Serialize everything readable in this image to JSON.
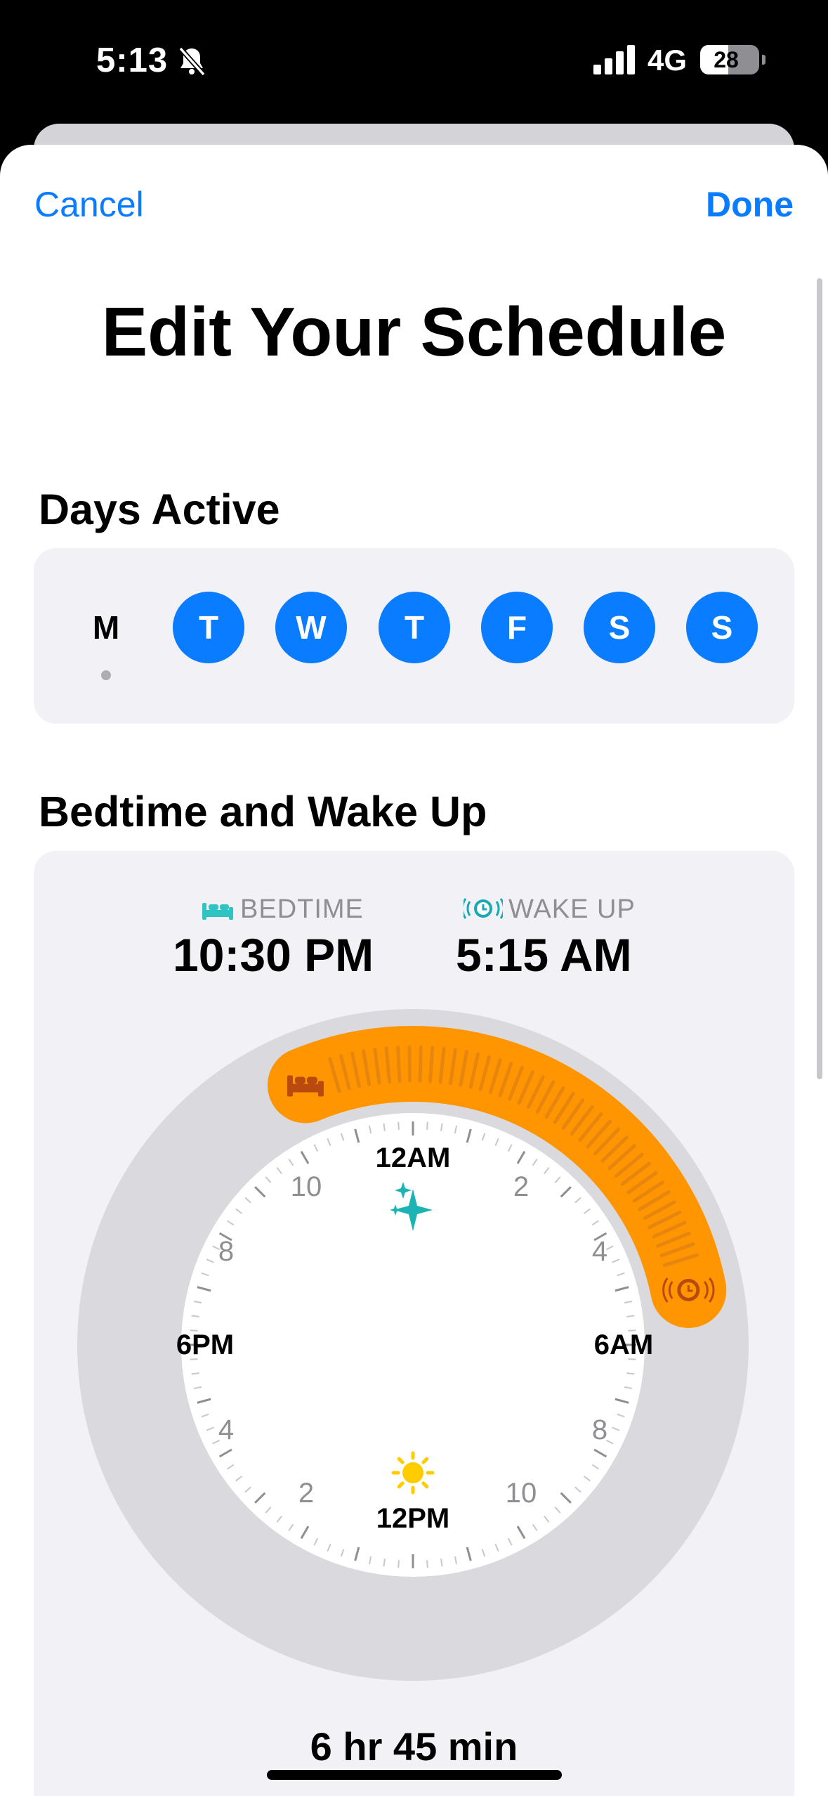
{
  "status_bar": {
    "time": "5:13",
    "network": "4G",
    "battery": "28"
  },
  "nav": {
    "cancel": "Cancel",
    "done": "Done"
  },
  "title": "Edit Your Schedule",
  "days_active": {
    "label": "Days Active",
    "days": [
      {
        "letter": "M",
        "active": false
      },
      {
        "letter": "T",
        "active": true
      },
      {
        "letter": "W",
        "active": true
      },
      {
        "letter": "T",
        "active": true
      },
      {
        "letter": "F",
        "active": true
      },
      {
        "letter": "S",
        "active": true
      },
      {
        "letter": "S",
        "active": true
      }
    ]
  },
  "bedtime_wake": {
    "label": "Bedtime and Wake Up",
    "bedtime_label": "BEDTIME",
    "bedtime": "10:30 PM",
    "wake_label": "WAKE UP",
    "wake": "5:15 AM",
    "duration": "6 hr 45 min"
  },
  "clock_face": {
    "labels": [
      "12AM",
      "2",
      "4",
      "6AM",
      "8",
      "10",
      "12PM",
      "2",
      "4",
      "6PM",
      "8",
      "10"
    ]
  },
  "colors": {
    "accent": "#0a7cff",
    "arc": "#ff9500",
    "bed_icon": "#2ec4c4",
    "alarm_icon": "#17a9b5",
    "sun": "#ffcc00"
  },
  "icons": [
    "bell-slash-icon",
    "signal-icon",
    "battery-icon",
    "bed-icon",
    "alarm-icon",
    "sparkles-icon",
    "sun-icon"
  ]
}
